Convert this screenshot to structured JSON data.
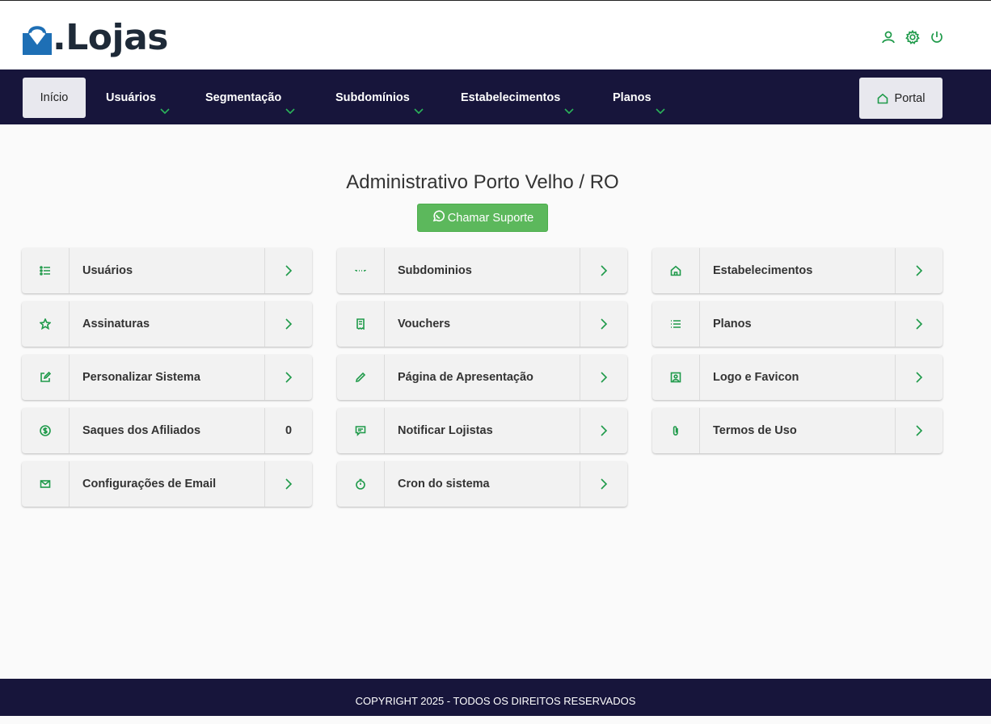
{
  "brand": {
    "name": "Lojas",
    "prefix_mark": "M",
    "dot": "."
  },
  "user_menu": {
    "icons": [
      "user-icon",
      "gear-icon",
      "power-icon"
    ]
  },
  "nav": {
    "home": "Início",
    "items": [
      {
        "label": "Usuários"
      },
      {
        "label": "Segmentação"
      },
      {
        "label": "Subdomínios"
      },
      {
        "label": "Estabelecimentos"
      },
      {
        "label": "Planos"
      }
    ],
    "portal": "Portal"
  },
  "main": {
    "title": "Administrativo Porto Velho / RO",
    "support_button": "Chamar Suporte",
    "cards": [
      {
        "label": "Usuários",
        "icon": "list-icon",
        "end": ""
      },
      {
        "label": "Subdominios",
        "icon": "dots-icon",
        "end": ""
      },
      {
        "label": "Estabelecimentos",
        "icon": "home-icon",
        "end": ""
      },
      {
        "label": "Assinaturas",
        "icon": "star-icon",
        "end": ""
      },
      {
        "label": "Vouchers",
        "icon": "receipt-icon",
        "end": ""
      },
      {
        "label": "Planos",
        "icon": "list-lines-icon",
        "end": ""
      },
      {
        "label": "Personalizar Sistema",
        "icon": "edit-icon",
        "end": ""
      },
      {
        "label": "Página de Apresentação",
        "icon": "pencil-icon",
        "end": ""
      },
      {
        "label": "Logo e Favicon",
        "icon": "image-icon",
        "end": ""
      },
      {
        "label": "Saques dos Afiliados",
        "icon": "dollar-icon",
        "end": "0"
      },
      {
        "label": "Notificar Lojistas",
        "icon": "message-icon",
        "end": ""
      },
      {
        "label": "Termos de Uso",
        "icon": "paperclip-icon",
        "end": ""
      },
      {
        "label": "Configurações de Email",
        "icon": "mail-icon",
        "end": ""
      },
      {
        "label": "Cron do sistema",
        "icon": "timer-icon",
        "end": ""
      }
    ]
  },
  "footer": {
    "text": "COPYRIGHT 2025 - TODOS OS DIREITOS RESERVADOS"
  },
  "colors": {
    "nav_bg": "#17153b",
    "accent": "#1f9a4a",
    "support": "#5cb85c"
  }
}
